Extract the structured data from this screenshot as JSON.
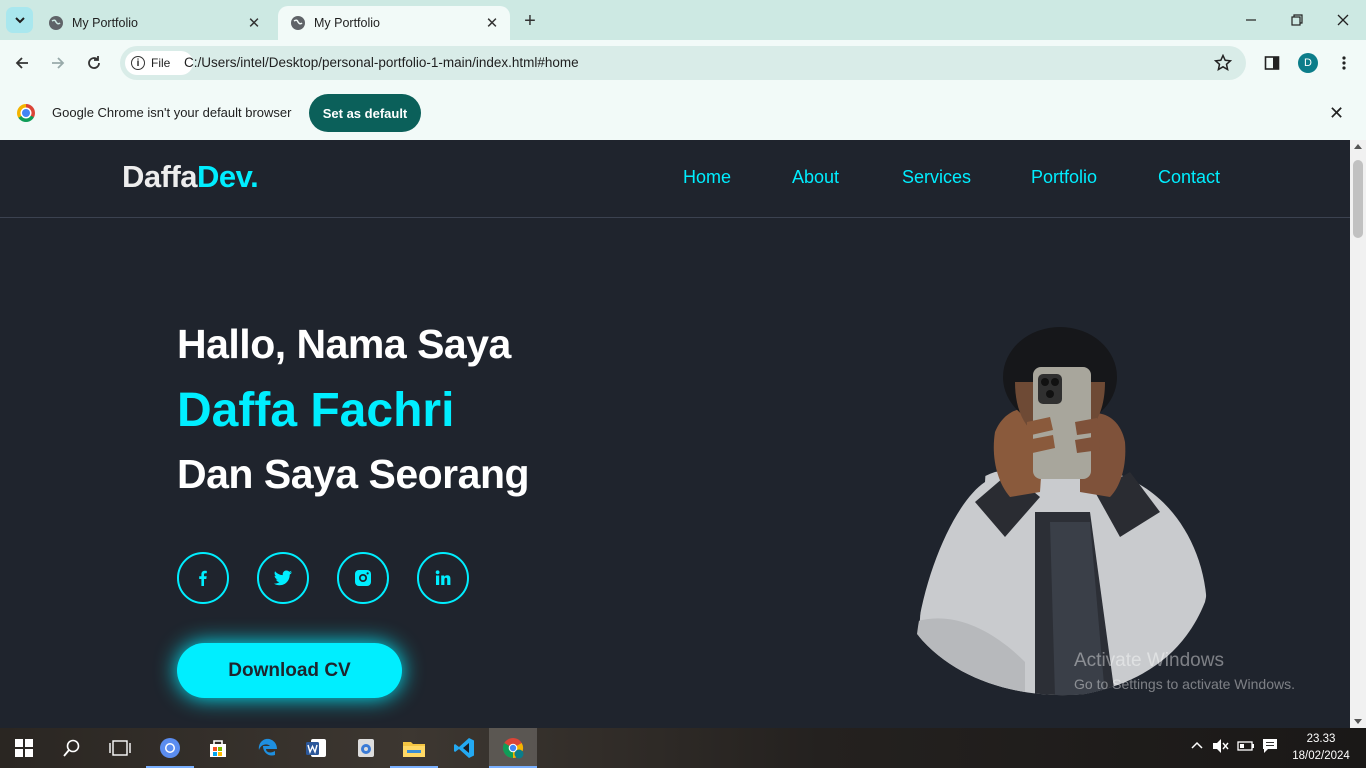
{
  "browser": {
    "tabs": [
      {
        "title": "My Portfolio",
        "active": false
      },
      {
        "title": "My Portfolio",
        "active": true
      }
    ],
    "address": {
      "scheme_label": "File",
      "url": "C:/Users/intel/Desktop/personal-portfolio-1-main/index.html#home"
    },
    "profile_initial": "D",
    "infobar": {
      "message": "Google Chrome isn't your default browser",
      "button": "Set as default"
    }
  },
  "site": {
    "logo_main": "Daffa",
    "logo_accent": "Dev.",
    "nav": [
      "Home",
      "About",
      "Services",
      "Portfolio",
      "Contact"
    ],
    "hero": {
      "greeting": "Hallo, Nama Saya",
      "name": "Daffa Fachri",
      "subtitle": "Dan Saya Seorang",
      "socials": [
        "facebook-icon",
        "twitter-icon",
        "instagram-icon",
        "linkedin-icon"
      ],
      "cta": "Download CV"
    },
    "colors": {
      "background": "#1f242d",
      "accent": "#00eeff",
      "text": "#ffffff"
    }
  },
  "watermark": {
    "line1": "Activate Windows",
    "line2": "Go to Settings to activate Windows."
  },
  "taskbar": {
    "apps": [
      "start-icon",
      "search-icon",
      "task-view-icon",
      "chromium-icon",
      "store-icon",
      "edge-icon",
      "word-icon",
      "app-icon",
      "file-explorer-icon",
      "vscode-icon",
      "chrome-icon"
    ],
    "clock_time": "23.33",
    "clock_date": "18/02/2024"
  }
}
